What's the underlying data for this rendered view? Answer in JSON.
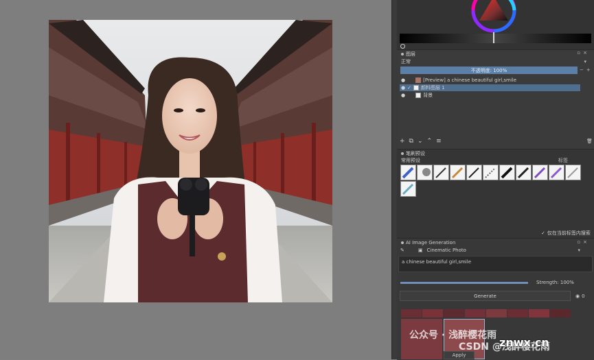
{
  "layers": {
    "panel_title": "图层",
    "blend_mode": "正常",
    "opacity_label": "不透明度:  100%",
    "items": [
      {
        "name": "[Preview] a chinese beautiful girl,smile"
      },
      {
        "name": "颜料图层 1"
      },
      {
        "name": "背景"
      }
    ]
  },
  "brushes": {
    "panel_title": "笔刷预设",
    "tag": "常用预设",
    "tag_label": "标签",
    "search_label": "仅在当前标签内搜索"
  },
  "ai": {
    "panel_title": "AI Image Generation",
    "style": "Cinematic Photo",
    "prompt": "a chinese beautiful girl,smile",
    "strength_label": "Strength: 100%",
    "generate_label": "Generate",
    "seed_count": "0",
    "apply_label": "Apply"
  },
  "watermarks": {
    "wechat": "公众号 · 浅醉樱花雨",
    "csdn": "CSDN @浅醉樱花雨",
    "site": "znwx.cn"
  },
  "colors": {
    "selection": "#4e6d8f",
    "panel_bg": "#333333",
    "canvas_bg": "#7e7e7e"
  }
}
